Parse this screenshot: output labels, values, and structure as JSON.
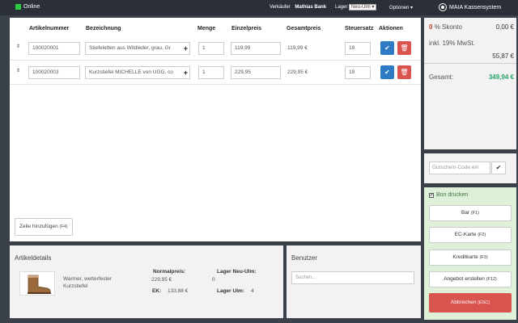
{
  "topbar": {
    "status": "Online",
    "seller_label": "Verkäufer",
    "seller_name": "Mathias Bank",
    "lager_label": "Lager",
    "lager_value": "Neu-Ulm",
    "options": "Optionen",
    "brand": "MAIA Kassensystem"
  },
  "cart": {
    "headers": {
      "article": "Artikelnummer",
      "description": "Bezeichnung",
      "qty": "Menge",
      "unit_price": "Einzelpreis",
      "total": "Gesamtpreis",
      "tax": "Steuersatz",
      "actions": "Aktionen"
    },
    "rows": [
      {
        "article": "100020001",
        "description": "Stiefeletten aus Wildleder, grau, Gr",
        "qty": "1",
        "unit_price": "119,99",
        "total": "119,99 €",
        "tax": "19"
      },
      {
        "article": "100020003",
        "description": "Kurzstiefel MICHELLE von UGG, co",
        "qty": "1",
        "unit_price": "229,95",
        "total": "229,95 €",
        "tax": "19"
      }
    ],
    "add_line_label": "Zeile hinzufügen",
    "add_line_key": "(F4)"
  },
  "details": {
    "title": "Artikeldetails",
    "name_line1": "Warmer, wetterfester",
    "name_line2": "Kurzstiefel",
    "normal_price_label": "Normalpreis:",
    "normal_price": "229,95 €",
    "ek_label": "EK:",
    "ek_value": "133,88 €",
    "lager_neu_ulm_label": "Lager Neu-Ulm:",
    "lager_neu_ulm_value": "0",
    "lager_ulm_label": "Lager Ulm:",
    "lager_ulm_value": "4"
  },
  "benutzer": {
    "title": "Benutzer",
    "search_placeholder": "Suchen..."
  },
  "totals": {
    "skonto_num": "0",
    "skonto_label": "% Skonto",
    "skonto_value": "0,00 €",
    "mwst_label": "inkl. 19% MwSt.",
    "mwst_value": "55,87 €",
    "gesamt_label": "Gesamt:",
    "gesamt_value": "349,94 €"
  },
  "voucher": {
    "placeholder": "Gutschein-Code ein"
  },
  "payment": {
    "bon_label": "Bon drucken",
    "buttons": [
      {
        "label": "Bar",
        "key": "(F1)"
      },
      {
        "label": "EC-Karte",
        "key": "(F2)"
      },
      {
        "label": "Kreditkarte",
        "key": "(F3)"
      },
      {
        "label": "Angebot erstellen",
        "key": "(F12)"
      }
    ],
    "cancel_label": "Abbrechen",
    "cancel_key": "(ESC)"
  },
  "icons": {
    "online": "status-dot-icon",
    "brand": "maia-logo-icon",
    "confirm": "check-icon",
    "delete": "trash-icon",
    "drag": "sort-arrows-icon",
    "add": "plus-icon"
  },
  "colors": {
    "topbar": "#2b3038",
    "background": "#3b4149",
    "online": "#2ecc40",
    "primary": "#2f7ac4",
    "danger": "#d9534f",
    "total_green": "#27a36a",
    "payment_bg": "#dff0d8"
  }
}
